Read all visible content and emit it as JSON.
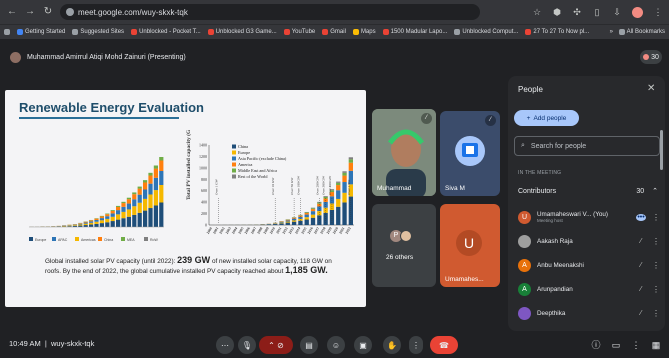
{
  "browser": {
    "url": "meet.google.com/wuy-skxk-tqk",
    "bookmarks": [
      "Getting Started",
      "Suggested Sites",
      "Unblocked - Pocket T...",
      "Unblocked G3 Game...",
      "YouTube",
      "Gmail",
      "Maps",
      "1500 Madular Lapo...",
      "Unblocked Comput...",
      "27 To 27 To Now pl..."
    ],
    "all_bookmarks": "All Bookmarks",
    "more": "»"
  },
  "meet": {
    "presenter": "Muhammad Amirrul Atiqi Mohd Zainuri (Presenting)",
    "people_count": "30",
    "meeting_code": "wuy-skxk-tqk",
    "time": "10:49 AM"
  },
  "slide": {
    "title": "Renewable Energy Evaluation",
    "body_pre": "Global installed solar PV capacity (until 2022):",
    "body_big1": "239 GW",
    "body_mid": "of new installed solar capacity, 118 GW on roofs. By the end of 2022, the global cumulative installed PV capacity reached about",
    "body_big2": "1,185 GW."
  },
  "chart_data": [
    {
      "type": "bar",
      "title": "",
      "legend": [
        "Europe",
        "APAC",
        "Americas",
        "China",
        "MEA",
        "RoW"
      ],
      "ylabel": "",
      "values": [
        1,
        1,
        2,
        2,
        3,
        4,
        6,
        8,
        10,
        14,
        19,
        24,
        30,
        38,
        46,
        58,
        72,
        86,
        100,
        118,
        138,
        160,
        185,
        210,
        239
      ]
    },
    {
      "type": "bar",
      "ylabel": "Total PV installed capacity (GW)",
      "ylim": [
        0,
        1400
      ],
      "yticks": [
        "1400",
        "1200",
        "1000",
        "800",
        "600",
        "400",
        "200",
        "0"
      ],
      "legend": [
        "China",
        "Europe",
        "Asia Pacific (exclude China)",
        "America",
        "Middle East and Africa",
        "Rest of the World"
      ],
      "legend_colors": [
        "#1f4e79",
        "#f5b800",
        "#2e75b6",
        "#ff7f0e",
        "#70ad47",
        "#7f7f7f"
      ],
      "categories": [
        "2000",
        "2001",
        "2002",
        "2003",
        "2004",
        "2005",
        "2006",
        "2007",
        "2008",
        "2009",
        "2010",
        "2011",
        "2012",
        "2013",
        "2014",
        "2015",
        "2016",
        "2017",
        "2018",
        "2019",
        "2020",
        "2021",
        "2022"
      ],
      "values": [
        1,
        1,
        2,
        3,
        4,
        5,
        7,
        9,
        16,
        23,
        40,
        70,
        100,
        138,
        178,
        228,
        303,
        405,
        505,
        627,
        760,
        940,
        1185
      ],
      "annotations": [
        "Over 1 GW",
        "Over 10 GW",
        "Over 50 GW",
        "Over 100 GW",
        "Over 200 GW",
        "Over 300 GW",
        "Over 400 GW",
        "Over 1 TW"
      ]
    }
  ],
  "tiles": [
    {
      "name": "Muhammad",
      "color": "#6b7a6c"
    },
    {
      "name": "Siva M",
      "color": "#3b4c6b"
    },
    {
      "name": "26 others",
      "color": "#3c4043"
    },
    {
      "name": "Umamahes...",
      "initial": "U",
      "color": "#d05a30"
    }
  ],
  "people_panel": {
    "title": "People",
    "add_people": "Add people",
    "search_placeholder": "Search for people",
    "section": "IN THE MEETING",
    "contributors_label": "Contributors",
    "contributors_count": "30",
    "people": [
      {
        "name": "Umamaheswari V... (You)",
        "sub": "Meeting host",
        "initial": "U",
        "color": "#d05a30"
      },
      {
        "name": "Aakash Raja",
        "sub": "",
        "initial": "",
        "color": "#9e9e9e"
      },
      {
        "name": "Anbu Meenakshi",
        "sub": "",
        "initial": "A",
        "color": "#e8710a"
      },
      {
        "name": "Arunpandian",
        "sub": "",
        "initial": "A",
        "color": "#188038"
      },
      {
        "name": "Deepthika",
        "sub": "",
        "initial": "",
        "color": "#7e57c2"
      }
    ]
  },
  "controls": [
    "mic-icon",
    "present-icon",
    "emoji-icon",
    "captions-icon",
    "raise-hand-icon",
    "more-icon",
    "end-call-icon"
  ]
}
